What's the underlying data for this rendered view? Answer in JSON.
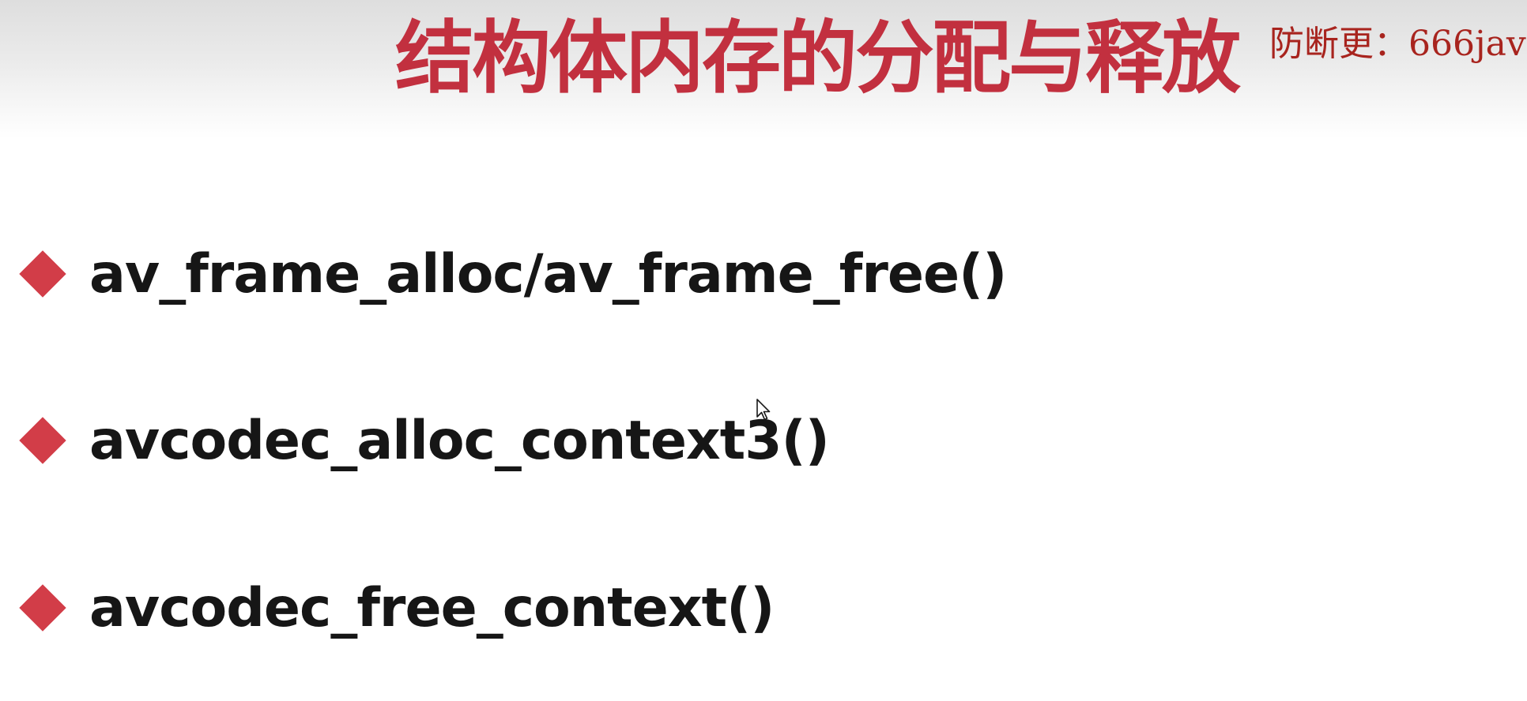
{
  "slide": {
    "title": "结构体内存的分配与释放",
    "watermark": "防断更：666jav",
    "bullets": [
      {
        "text": "av_frame_alloc/av_frame_free()"
      },
      {
        "text": "avcodec_alloc_context3()"
      },
      {
        "text": "avcodec_free_context()"
      }
    ]
  },
  "colors": {
    "title": "#c2303f",
    "bullet_marker": "#d23d48",
    "body_text": "#161616",
    "watermark": "#a8241e"
  },
  "icons": {
    "bullet_marker": "diamond-bullet-icon",
    "cursor": "mouse-pointer-icon"
  }
}
